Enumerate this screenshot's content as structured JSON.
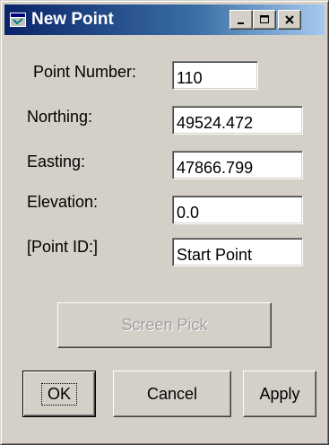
{
  "window": {
    "title": "New Point",
    "minimize_label": "_",
    "maximize_label": "□",
    "close_label": "×"
  },
  "form": {
    "point_number": {
      "label": "Point Number:",
      "value": "110"
    },
    "northing": {
      "label": "Northing:",
      "value": "49524.472"
    },
    "easting": {
      "label": "Easting:",
      "value": "47866.799"
    },
    "elevation": {
      "label": "Elevation:",
      "value": "0.0"
    },
    "point_id": {
      "label": "[Point ID:]",
      "value": "Start Point"
    }
  },
  "buttons": {
    "screen_pick": "Screen Pick",
    "ok": "OK",
    "cancel": "Cancel",
    "apply": "Apply"
  },
  "colors": {
    "face": "#d4d0c8",
    "titlebar_start": "#0a246a",
    "titlebar_end": "#a6caf0",
    "disabled_text": "#a0a0a0"
  },
  "icons": {
    "title": "app-window-icon",
    "minimize": "minimize-icon",
    "maximize": "maximize-icon",
    "close": "close-icon"
  }
}
